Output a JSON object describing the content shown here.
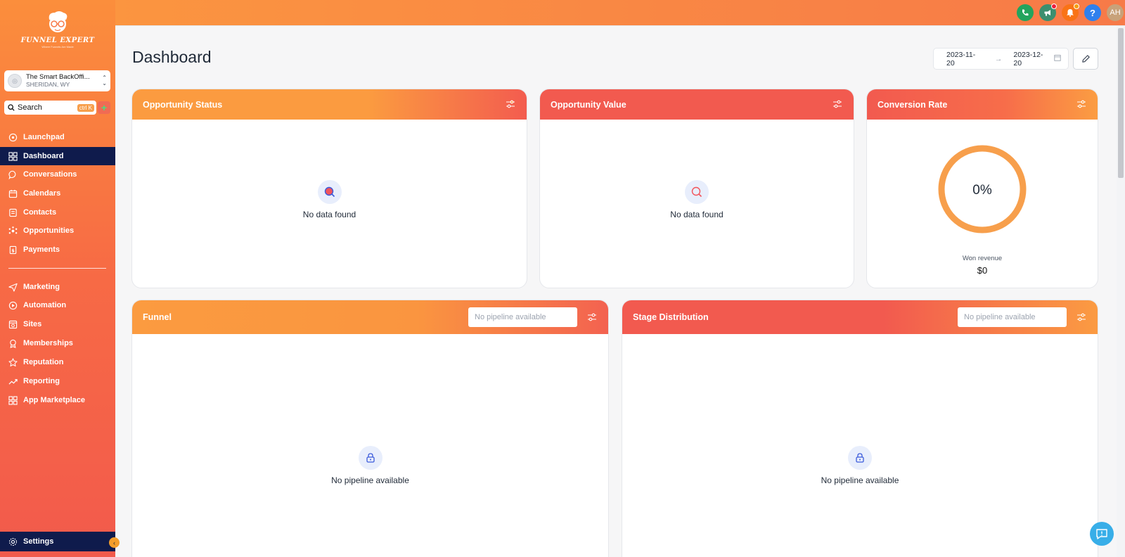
{
  "brand": {
    "name": "FUNNEL EXPERT",
    "tagline": "Where Funnels Are Made"
  },
  "location": {
    "name": "The Smart BackOffi...",
    "sub": "SHERIDAN, WY"
  },
  "search": {
    "label": "Search",
    "shortcut": "ctrl K",
    "plus": "+"
  },
  "nav": {
    "items": [
      {
        "label": "Launchpad",
        "icon": "rocket-icon"
      },
      {
        "label": "Dashboard",
        "icon": "grid-icon",
        "active": true
      },
      {
        "label": "Conversations",
        "icon": "chat-icon"
      },
      {
        "label": "Calendars",
        "icon": "calendar-icon"
      },
      {
        "label": "Contacts",
        "icon": "contacts-icon"
      },
      {
        "label": "Opportunities",
        "icon": "opportunities-icon"
      },
      {
        "label": "Payments",
        "icon": "payments-icon"
      },
      {
        "label": "Marketing",
        "icon": "send-icon"
      },
      {
        "label": "Automation",
        "icon": "automation-icon"
      },
      {
        "label": "Sites",
        "icon": "sites-icon"
      },
      {
        "label": "Memberships",
        "icon": "award-icon"
      },
      {
        "label": "Reputation",
        "icon": "star-icon"
      },
      {
        "label": "Reporting",
        "icon": "trend-icon"
      },
      {
        "label": "App Marketplace",
        "icon": "apps-icon"
      }
    ],
    "settings": "Settings"
  },
  "topbar": {
    "help": "?",
    "avatar": "AH"
  },
  "page": {
    "title": "Dashboard",
    "date_start": "2023-11-20",
    "date_end": "2023-12-20",
    "arrow": "→"
  },
  "cards": {
    "opportunity_status": {
      "title": "Opportunity Status",
      "empty": "No data found"
    },
    "opportunity_value": {
      "title": "Opportunity Value",
      "empty": "No data found"
    },
    "conversion_rate": {
      "title": "Conversion Rate",
      "percent": "0%",
      "won_label": "Won revenue",
      "won_value": "$0"
    },
    "funnel": {
      "title": "Funnel",
      "select_placeholder": "No pipeline available",
      "empty": "No pipeline available"
    },
    "stage_distribution": {
      "title": "Stage Distribution",
      "select_placeholder": "No pipeline available",
      "empty": "No pipeline available"
    }
  },
  "colors": {
    "accent": "#fb9b40",
    "red": "#f25a4f",
    "navy": "#0f1b4c",
    "donut": "#f79f4c"
  }
}
